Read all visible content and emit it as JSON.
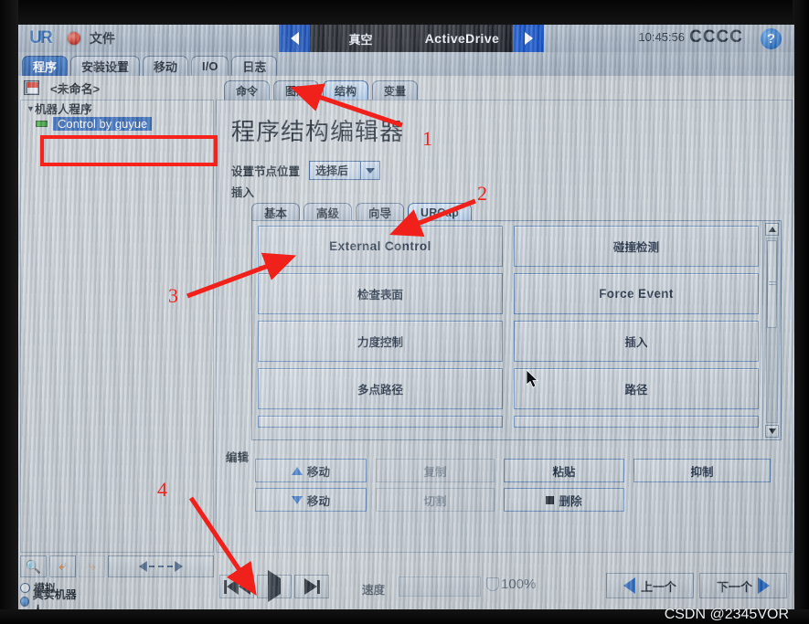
{
  "titlebar": {
    "logo": "UR",
    "file_menu": "文件",
    "left_nav_icon": "chevron-left-icon",
    "right_nav_icon": "chevron-right-icon",
    "center_left_text": "真空",
    "center_right_text": "ActiveDrive",
    "clock": "10:45:56",
    "robot_name": "CCCC",
    "help_icon": "?"
  },
  "main_tabs": [
    {
      "label": "程序",
      "active": true
    },
    {
      "label": "安装设置",
      "active": false
    },
    {
      "label": "移动",
      "active": false
    },
    {
      "label": "I/O",
      "active": false
    },
    {
      "label": "日志",
      "active": false
    }
  ],
  "file_row": {
    "save_icon": "save-icon",
    "program_name": "<未命名>"
  },
  "sub_tabs": [
    {
      "label": "命令",
      "active": false
    },
    {
      "label": "图形",
      "active": false
    },
    {
      "label": "结构",
      "active": true
    },
    {
      "label": "变量",
      "active": false
    }
  ],
  "tree": {
    "root_label": "机器人程序",
    "items": [
      {
        "label": "Control by guyue",
        "selected": true
      }
    ]
  },
  "left_bottom": {
    "zoom_in_icon": "magnifier-plus-icon",
    "zoom_out_icon": "magnifier-minus-icon",
    "undo_icon": "undo-arrow-icon",
    "redo_icon": "redo-arrow-icon",
    "pan_slider_icon": "pan-slider-icon",
    "mode_options": [
      {
        "label": "模拟",
        "selected": false
      },
      {
        "label": "真实机器人",
        "selected": true
      }
    ]
  },
  "content": {
    "page_title": "程序结构编辑器",
    "node_position_label": "设置节点位置",
    "node_position_value": "选择后",
    "insert_label": "插入",
    "command_tabs": [
      {
        "label": "基本",
        "active": false
      },
      {
        "label": "高级",
        "active": false
      },
      {
        "label": "向导",
        "active": false
      },
      {
        "label": "URCap",
        "active": true
      }
    ],
    "urcap_buttons": [
      {
        "label": "External Control",
        "lang": "en"
      },
      {
        "label": "碰撞检测",
        "lang": "zh"
      },
      {
        "label": "检查表面",
        "lang": "zh"
      },
      {
        "label": "Force Event",
        "lang": "en"
      },
      {
        "label": "力度控制",
        "lang": "zh"
      },
      {
        "label": "插入",
        "lang": "zh"
      },
      {
        "label": "多点路径",
        "lang": "zh"
      },
      {
        "label": "路径",
        "lang": "zh"
      }
    ],
    "scrollbar": {
      "up_icon": "scroll-up-arrow-icon",
      "down_icon": "scroll-down-arrow-icon"
    },
    "edit_label": "编辑",
    "edit_buttons": {
      "move_up": "移动",
      "move_down": "移动",
      "copy": "复制",
      "cut": "切割",
      "paste": "粘贴",
      "delete": "删除",
      "suppress": "抑制",
      "move_up_icon": "arrow-up-icon",
      "move_down_icon": "arrow-down-icon",
      "delete_icon": "delete-square-icon"
    }
  },
  "bottom_bar": {
    "play_prev_icon": "skip-back-icon",
    "play_icon": "play-icon",
    "play_next_icon": "skip-forward-icon",
    "speed_label": "速度",
    "speed_value": "100%",
    "speed_icon": "shield-icon",
    "prev_button": "上一个",
    "next_button": "下一个",
    "prev_icon": "arrow-left-icon",
    "next_icon": "arrow-right-icon"
  },
  "annotations": {
    "numbers": [
      "1",
      "2",
      "3",
      "4"
    ],
    "color": "#f0201a",
    "highlight_box_color": "#f5231c"
  },
  "watermark": "CSDN @2345VOR"
}
